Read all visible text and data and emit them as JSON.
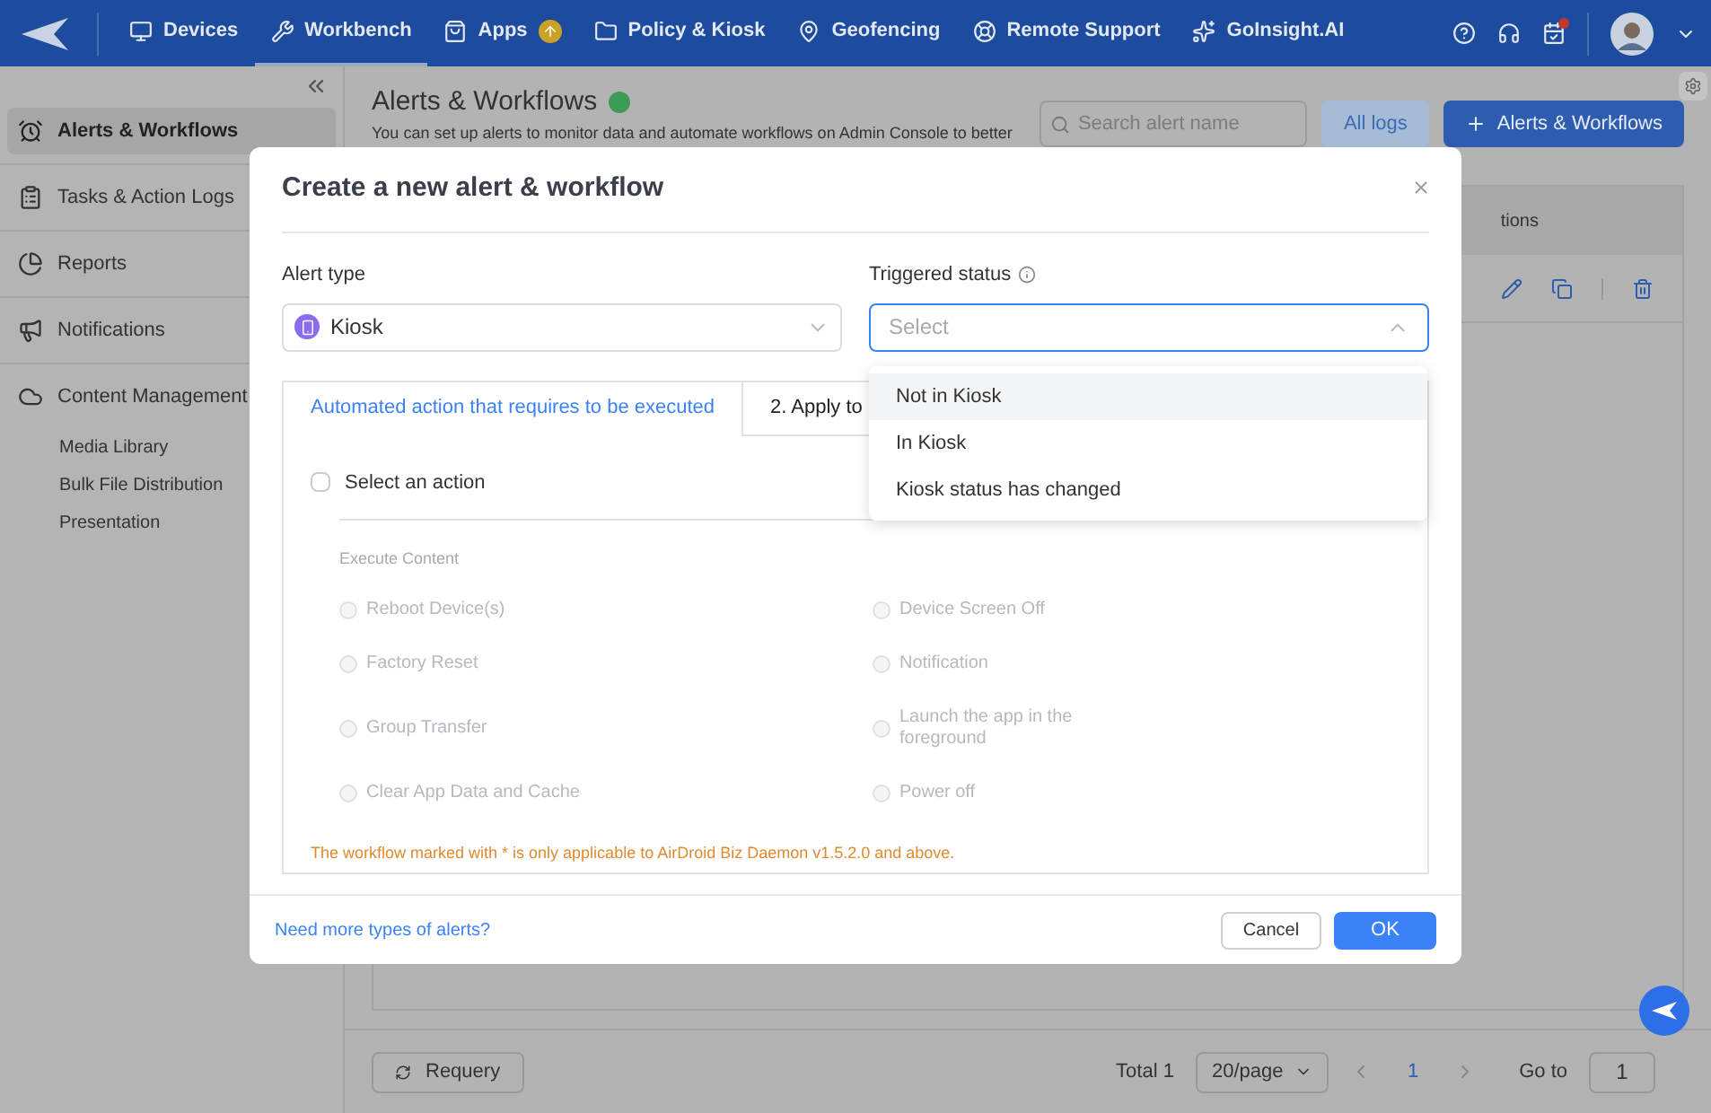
{
  "nav": {
    "items": [
      {
        "label": "Devices",
        "selected": false
      },
      {
        "label": "Workbench",
        "selected": true
      },
      {
        "label": "Apps",
        "selected": false,
        "badge": true
      },
      {
        "label": "Policy & Kiosk",
        "selected": false
      },
      {
        "label": "Geofencing",
        "selected": false
      },
      {
        "label": "Remote Support",
        "selected": false
      },
      {
        "label": "GoInsight.AI",
        "selected": false
      }
    ]
  },
  "sidebar": {
    "items": [
      {
        "label": "Alerts & Workflows",
        "selected": true
      },
      {
        "label": "Tasks & Action Logs",
        "selected": false
      },
      {
        "label": "Reports",
        "selected": false
      },
      {
        "label": "Notifications",
        "selected": false
      },
      {
        "label": "Content Management",
        "selected": false,
        "children": [
          {
            "label": "Media Library"
          },
          {
            "label": "Bulk File Distribution"
          },
          {
            "label": "Presentation"
          }
        ]
      }
    ]
  },
  "page": {
    "title": "Alerts & Workflows",
    "description": "You can set up alerts to monitor data and automate workflows on Admin Console to better",
    "search_placeholder": "Search alert name",
    "logs_button": "All logs",
    "add_button": "Alerts & Workflows",
    "column_header": "tions"
  },
  "footer": {
    "requery": "Requery",
    "total": "Total 1",
    "page_size": "20/page",
    "current_page": "1",
    "goto_label": "Go to",
    "goto_value": "1"
  },
  "modal": {
    "title": "Create a new alert & workflow",
    "alert_type_label": "Alert type",
    "alert_type_value": "Kiosk",
    "triggered_label": "Triggered status",
    "triggered_placeholder": "Select",
    "dropdown_open": true,
    "options": [
      {
        "label": "Not in Kiosk",
        "selected": true
      },
      {
        "label": "In Kiosk",
        "selected": false
      },
      {
        "label": "Kiosk status has changed",
        "selected": false
      }
    ],
    "tabs": [
      {
        "label": "Automated action that requires to be executed",
        "selected": true
      },
      {
        "label": "2. Apply to",
        "selected": false
      }
    ],
    "select_action": {
      "label": "Select an action",
      "checked": false
    },
    "section_label": "Execute Content",
    "actions": [
      {
        "label": "Reboot Device(s)",
        "disabled": true
      },
      {
        "label": "Device Screen Off",
        "disabled": true
      },
      {
        "label": "Factory Reset",
        "disabled": true
      },
      {
        "label": "Notification",
        "disabled": true
      },
      {
        "label": "Group Transfer",
        "disabled": true
      },
      {
        "label": "Launch the app in the foreground",
        "disabled": true
      },
      {
        "label": "Clear App Data and Cache",
        "disabled": true
      },
      {
        "label": "Power off",
        "disabled": true
      }
    ],
    "note": "The workflow marked with * is only applicable to AirDroid Biz Daemon v1.5.2.0 and above.",
    "help_link": "Need more types of alerts?",
    "cancel": "Cancel",
    "ok": "OK"
  }
}
